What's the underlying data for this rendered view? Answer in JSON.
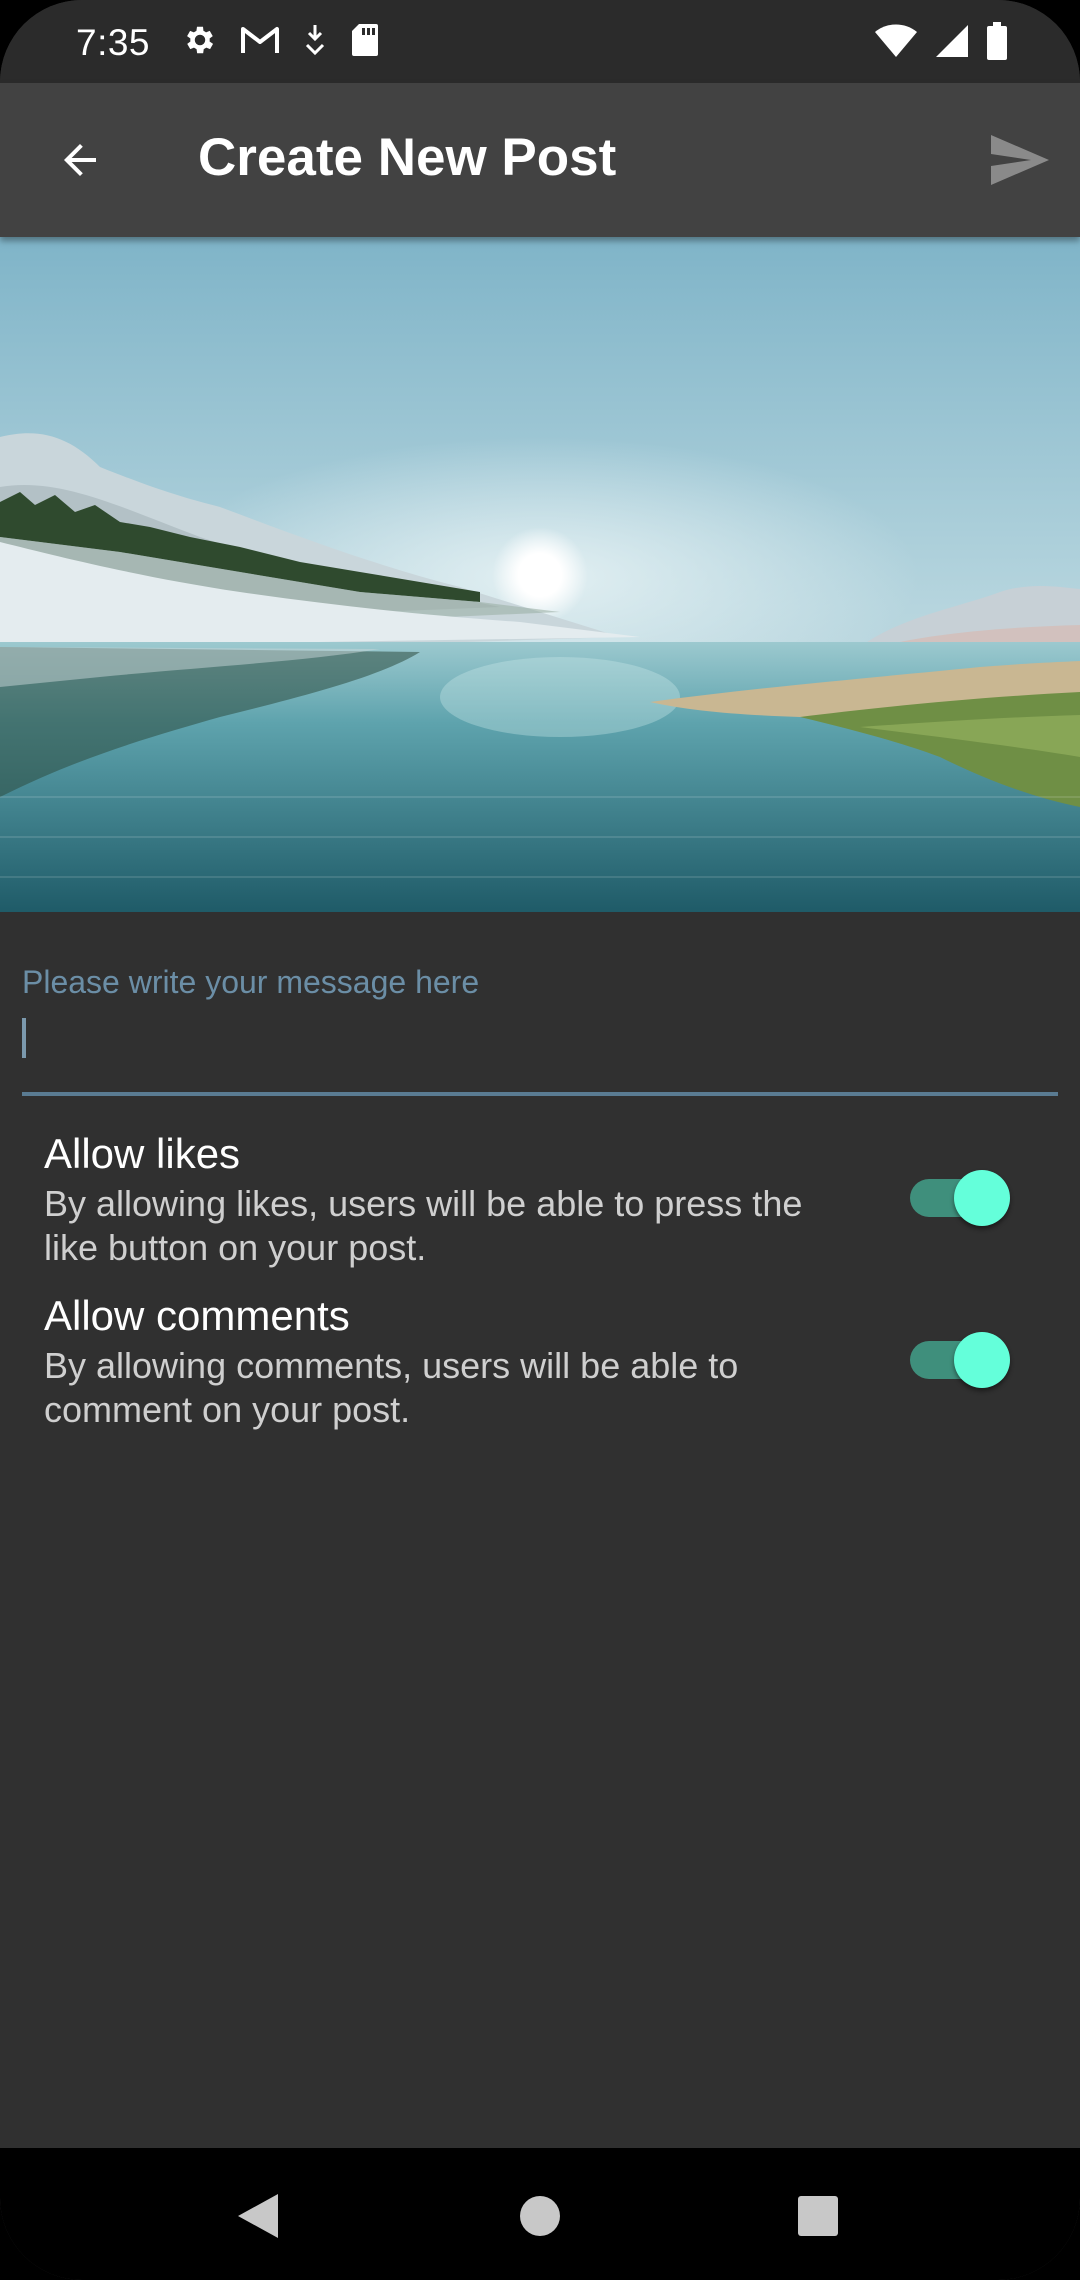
{
  "status_bar": {
    "time": "7:35",
    "left_icons": [
      "gear-icon",
      "gmail-icon",
      "download-icon",
      "sd-card-icon"
    ],
    "right_icons": [
      "wifi-icon",
      "signal-icon",
      "battery-icon"
    ]
  },
  "app_bar": {
    "title": "Create New Post",
    "back_icon": "arrow-back-icon",
    "send_icon": "send-icon"
  },
  "post": {
    "image_subject": "landscape-lake-photo"
  },
  "message_field": {
    "placeholder": "Please write your message here",
    "value": ""
  },
  "settings": [
    {
      "title": "Allow likes",
      "description": "By allowing likes, users will be able to press the like button on your post.",
      "enabled": true
    },
    {
      "title": "Allow comments",
      "description": "By allowing comments, users will be able to comment on your post.",
      "enabled": true
    }
  ],
  "colors": {
    "background": "#303030",
    "app_bar": "#424242",
    "accent": "#64ffda",
    "accent_track": "#3f8f7c",
    "field_label": "#6b8ea6"
  },
  "nav_bar": {
    "icons": [
      "nav-back-icon",
      "nav-home-icon",
      "nav-recents-icon"
    ]
  }
}
